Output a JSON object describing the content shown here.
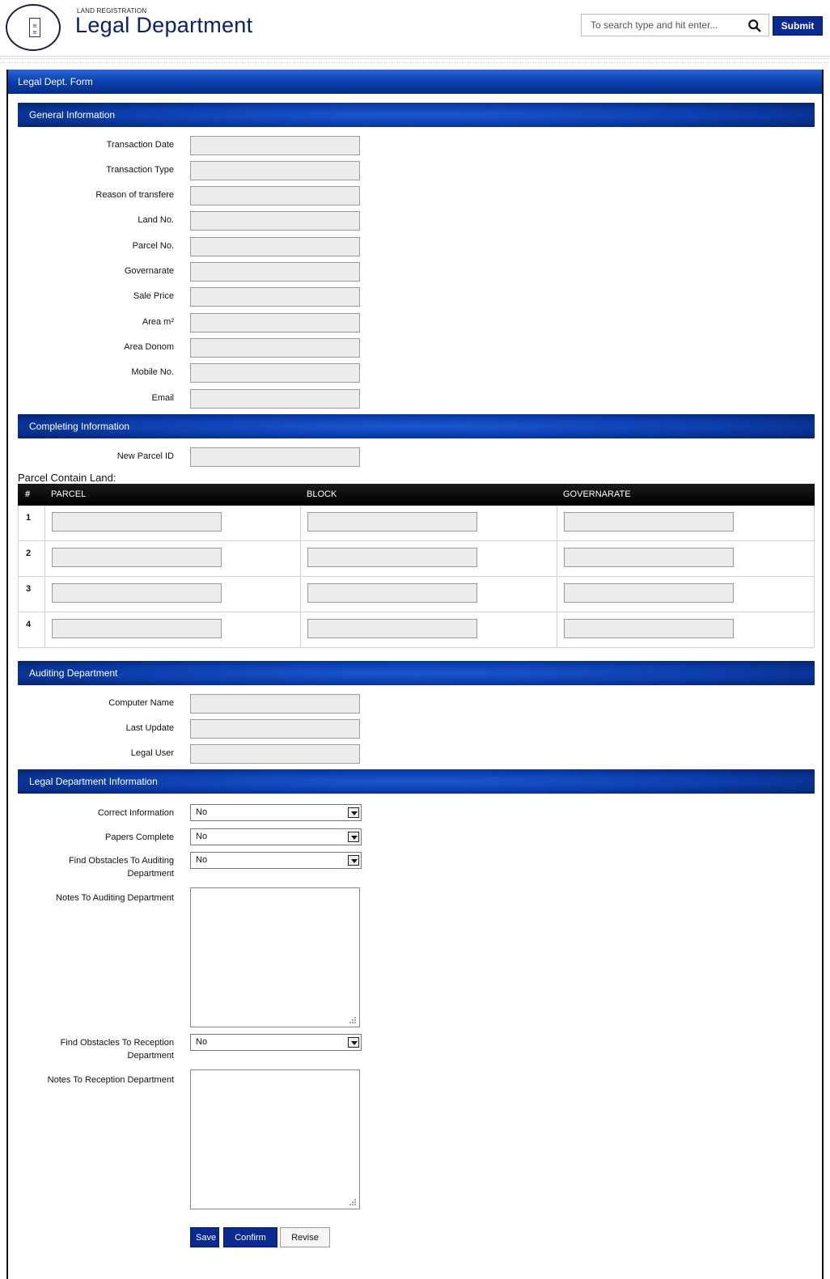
{
  "header": {
    "subtitle": "LAND REGISTRATION",
    "title": "Legal Department",
    "search_placeholder": "To search type and hit enter...",
    "submit_label": "Submit"
  },
  "form": {
    "title": "Legal Dept. Form",
    "general": {
      "heading": "General Information",
      "fields": [
        {
          "label": "Transaction Date",
          "value": ""
        },
        {
          "label": "Transaction Type",
          "value": ""
        },
        {
          "label": "Reason of transfere",
          "value": ""
        },
        {
          "label": "Land No.",
          "value": ""
        },
        {
          "label": "Parcel No.",
          "value": ""
        },
        {
          "label": "Governarate",
          "value": ""
        },
        {
          "label": "Sale Price",
          "value": ""
        },
        {
          "label": "Area m²",
          "value": ""
        },
        {
          "label": "Area Donom",
          "value": ""
        },
        {
          "label": "Mobile No.",
          "value": ""
        },
        {
          "label": "Email",
          "value": ""
        }
      ]
    },
    "completing": {
      "heading": "Completing Information",
      "new_parcel_label": "New Parcel ID",
      "table_caption": "Parcel Contain Land:",
      "columns": [
        "#",
        "PARCEL",
        "BLOCK",
        "GOVERNARATE"
      ],
      "rows": [
        "1",
        "2",
        "3",
        "4"
      ]
    },
    "auditing": {
      "heading": "Auditing Department",
      "fields": [
        {
          "label": "Computer Name",
          "value": ""
        },
        {
          "label": "Last Update",
          "value": ""
        },
        {
          "label": "Legal User",
          "value": ""
        }
      ]
    },
    "legal": {
      "heading": "Legal Department Information",
      "correct_info_label": "Correct Information",
      "correct_info_value": "No",
      "papers_label": "Papers Complete",
      "papers_value": "No",
      "obstacles_audit_label": "Find Obstacles To Auditing Department",
      "obstacles_audit_value": "No",
      "notes_audit_label": "Notes To Auditing Department",
      "obstacles_reception_label": "Find Obstacles To Reception Department",
      "obstacles_reception_value": "No",
      "notes_reception_label": "Notes To Reception Department"
    },
    "buttons": {
      "save": "Save",
      "confirm": "Confirm",
      "revise": "Revise"
    }
  },
  "colors": {
    "brand_blue": "#0a2a8f",
    "title_blue": "#0a1e6e"
  }
}
